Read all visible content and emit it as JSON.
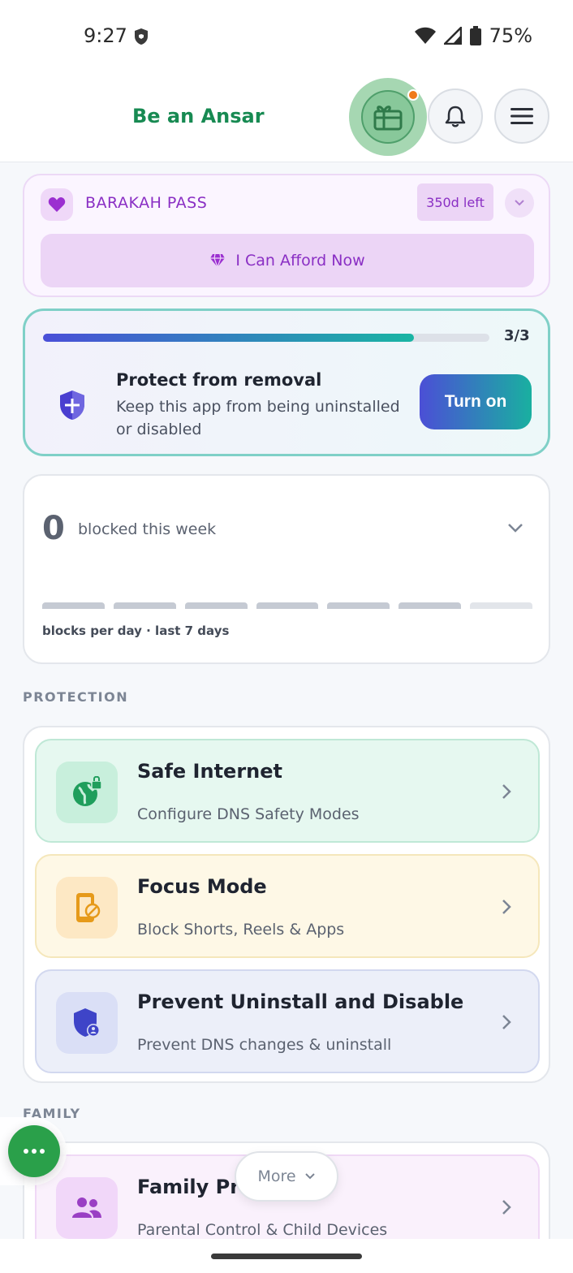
{
  "status_bar": {
    "time": "9:27",
    "battery": "75%"
  },
  "header": {
    "brand": "Be an Ansar"
  },
  "barakah": {
    "title": "BARAKAH PASS",
    "days_left": "350d left",
    "afford_label": "I Can Afford Now"
  },
  "protect": {
    "progress_fraction": 0.83,
    "progress_count": "3/3",
    "title": "Protect from removal",
    "description": "Keep this app from being uninstalled or disabled",
    "button": "Turn on"
  },
  "blocked": {
    "count": "0",
    "label": "blocked this week",
    "caption": "blocks per day · last 7 days",
    "daily_counts": [
      0,
      0,
      0,
      0,
      0,
      0,
      0
    ]
  },
  "sections": {
    "protection": "PROTECTION",
    "family": "FAMILY"
  },
  "features": [
    {
      "title": "Safe Internet",
      "subtitle": "Configure DNS Safety Modes",
      "icon": "globe-lock-icon",
      "color": "#1f9e5c"
    },
    {
      "title": "Focus Mode",
      "subtitle": "Block Shorts, Reels & Apps",
      "icon": "phone-block-icon",
      "color": "#e69a1a"
    },
    {
      "title": "Prevent Uninstall and Disable",
      "subtitle": "Prevent DNS changes & uninstall",
      "icon": "shield-user-icon",
      "color": "#3e44c8"
    },
    {
      "title": "Family Pro",
      "subtitle": "Parental Control & Child Devices",
      "icon": "family-icon",
      "color": "#9a3fc4"
    }
  ],
  "more": {
    "label": "More"
  },
  "colors": {
    "brand_green": "#178a52",
    "purple": "#8a2fc4",
    "accent_indigo": "#4a4fd8",
    "accent_teal": "#19b5a3"
  }
}
